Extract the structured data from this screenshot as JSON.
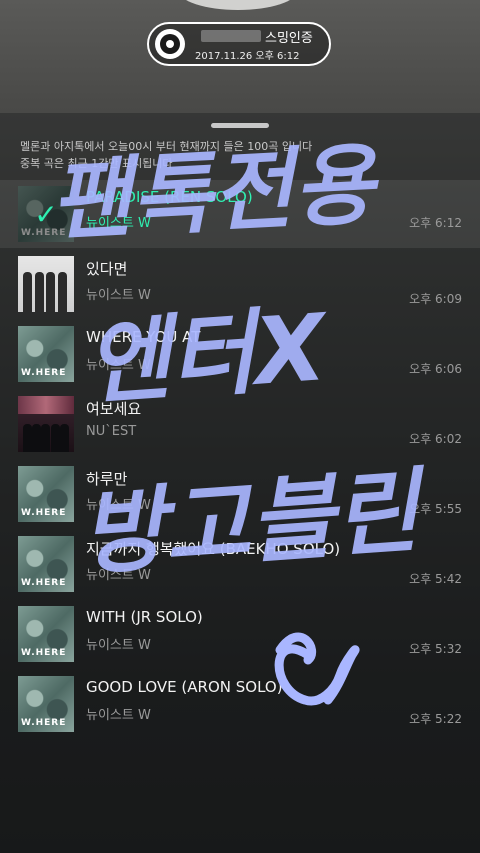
{
  "badge": {
    "title": "스밍인증",
    "date": "2017.11.26 오후 6:12"
  },
  "notice": {
    "line1": "멜론과 아지톡에서 오늘00시 부터 현재까지 들은 100곡 입니다",
    "line2": "중복 곡은 최근 1간만 표시됩니다"
  },
  "tracks": [
    {
      "title": "PARADISE (REN SOLO)",
      "artist": "뉴이스트 W",
      "time": "오후 6:12",
      "art": "where",
      "selected": true
    },
    {
      "title": "있다면",
      "artist": "뉴이스트 W",
      "time": "오후 6:09",
      "art": "band"
    },
    {
      "title": "WHERE YOU AT",
      "artist": "뉴이스트 W",
      "time": "오후 6:06",
      "art": "where"
    },
    {
      "title": "여보세요",
      "artist": "NU`EST",
      "time": "오후 6:02",
      "art": "stage"
    },
    {
      "title": "하루만",
      "artist": "뉴이스트 W",
      "time": "오후 5:55",
      "art": "where"
    },
    {
      "title": "지금까지 행복했어요 (BAEKHO SOLO)",
      "artist": "뉴이스트 W",
      "time": "오후 5:42",
      "art": "where"
    },
    {
      "title": "WITH (JR SOLO)",
      "artist": "뉴이스트 W",
      "time": "오후 5:32",
      "art": "where"
    },
    {
      "title": "GOOD LOVE (ARON SOLO)",
      "artist": "뉴이스트 W",
      "time": "오후 5:22",
      "art": "where"
    }
  ],
  "album_label": "W.HERE",
  "handwriting": {
    "line1": "팬톡전용",
    "line2": "엔터X",
    "line3": "방고블린",
    "color": "#a9b6ff"
  },
  "colors": {
    "accent": "#2ef0b2"
  }
}
